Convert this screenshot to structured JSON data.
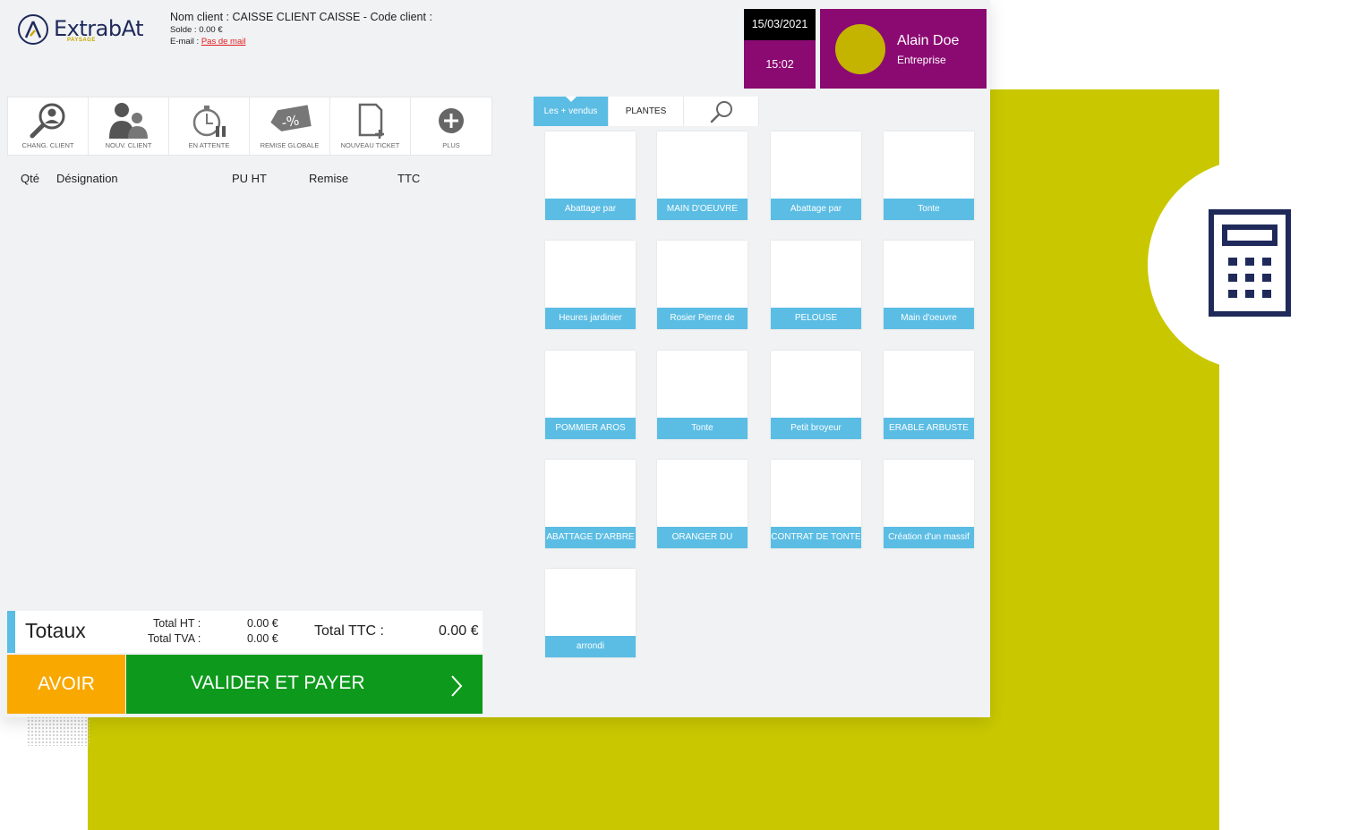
{
  "brand": {
    "name": "ExtrabAt",
    "sub": "PAYSAGE"
  },
  "client": {
    "line1": "Nom client : CAISSE CLIENT CAISSE - Code client :",
    "solde": "Solde : 0.00 €",
    "email_label": "E-mail : ",
    "email_link": "Pas de mail"
  },
  "datetime": {
    "date": "15/03/2021",
    "time": "15:02"
  },
  "user": {
    "name": "Alain Doe",
    "role": "Entreprise"
  },
  "toolbar": {
    "chang_client": "CHANG. CLIENT",
    "nouv_client": "NOUV. CLIENT",
    "en_attente": "EN ATTENTE",
    "remise_globale": "REMISE GLOBALE",
    "nouveau_ticket": "NOUVEAU TICKET",
    "plus": "PLUS"
  },
  "ticket": {
    "qte": "Qté",
    "designation": "Désignation",
    "pu_ht": "PU HT",
    "remise": "Remise",
    "ttc": "TTC"
  },
  "totals": {
    "title": "Totaux",
    "total_ht_label": "Total HT :",
    "total_ht_value": "0.00 €",
    "total_tva_label": "Total TVA :",
    "total_tva_value": "0.00 €",
    "total_ttc_label": "Total TTC :",
    "total_ttc_value": "0.00 €"
  },
  "actions": {
    "avoir": "AVOIR",
    "valider": "VALIDER ET PAYER"
  },
  "tabs": {
    "top_sold": "Les + vendus",
    "plantes": "PLANTES"
  },
  "products": [
    "Abattage par",
    "MAIN D'OEUVRE",
    "Abattage par",
    "Tonte",
    "Heures jardinier",
    "Rosier Pierre de",
    "PELOUSE",
    "Main d'oeuvre",
    "POMMIER AROS",
    "Tonte",
    "Petit broyeur",
    "ERABLE ARBUSTE",
    "ABATTAGE D'ARBRE",
    "ORANGER DU",
    "CONTRAT DE TONTE",
    "Création d'un massif",
    "arrondi"
  ],
  "colors": {
    "accent_blue": "#5bbde4",
    "purple": "#8b0a72",
    "green_bg": "#c9c800",
    "valider_green": "#0d9a1c",
    "avoir_orange": "#f9a800"
  },
  "icons": [
    "search-user-icon",
    "users-icon",
    "timer-pause-icon",
    "discount-tag-icon",
    "new-document-icon",
    "plus-circle-icon",
    "search-icon",
    "calculator-icon",
    "chevron-right-icon"
  ]
}
